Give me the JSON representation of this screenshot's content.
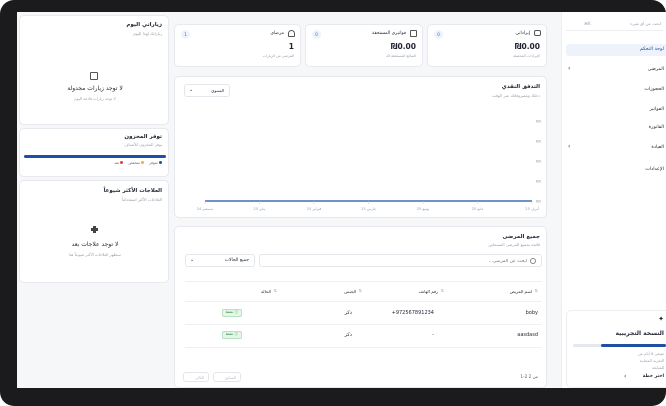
{
  "sidebar": {
    "search_placeholder": "ابحث عن أي شيء",
    "shortcut": "⌘K",
    "items": [
      {
        "label": "لوحة التحكم",
        "active": true
      },
      {
        "label": "المرضى",
        "has_children": true
      },
      {
        "label": "الحجوزات"
      },
      {
        "label": "الفواتير"
      },
      {
        "label": "الفاتورة"
      },
      {
        "label": "العيادة",
        "has_children": true
      },
      {
        "label": "الإعدادات"
      }
    ],
    "trial": {
      "title": "النسخة التجريبية",
      "line1": "متبقي 6 أيام من",
      "line2": "التجربة المجانية",
      "line3": "للمتابعة",
      "link": "اختر خطة"
    }
  },
  "stats": [
    {
      "label": "إيراداتي",
      "value": "₪0.00",
      "sub": "الإيرادات المحصلة",
      "badge": "0"
    },
    {
      "label": "فواتيري المستحقة",
      "value": "₪0.00",
      "sub": "المبالغ المستحقة لك",
      "badge": "0"
    },
    {
      "label": "مرضاي",
      "value": "1",
      "sub": "المرضى من الزيارات",
      "badge": "1"
    }
  ],
  "cashflow": {
    "title": "التدفق النقدي",
    "subtitle": "دخلك ومصروفاتك عبر الوقت",
    "period": "السنوي",
    "chart_data": {
      "type": "line",
      "x": [
        "أبريل 25",
        "مايو 25",
        "يونيو 25",
        "مارس 25",
        "فبراير 25",
        "يناير 25",
        "ديسمبر 24"
      ],
      "series": [
        {
          "values": [
            0,
            0,
            0,
            0,
            0,
            0,
            0
          ]
        }
      ],
      "yticks": [
        "₪0",
        "₪0",
        "₪0",
        "₪0",
        "₪0"
      ],
      "grid": false
    }
  },
  "visits": {
    "title": "زياراتي اليوم",
    "subtitle": "زياراتك لهذا اليوم",
    "empty_title": "لا توجد زيارات مجدولة",
    "empty_sub": "لا توجد زيارات قادمة اليوم"
  },
  "inventory": {
    "title": "توفر المخزون",
    "subtitle": "توفر المخزون للأصناف",
    "progress": 1.0,
    "bar_color": "#1d4fa3",
    "legend": [
      "متوفر",
      "منخفض",
      "نفد"
    ]
  },
  "treatments": {
    "title": "العلاجات الأكثر شيوعاً",
    "subtitle": "العلاجات الأكثر استخداماً",
    "empty_title": "لا توجد علاجات بعد",
    "empty_sub": "ستظهر العلاجات الأكثر شيوعاً هنا"
  },
  "patients": {
    "title": "جميع المرضى",
    "subtitle": "قائمة بجميع المرضى المسجلين",
    "search_placeholder": "ابحث عن المرضى...",
    "filter": "جميع الحالات",
    "columns": [
      "اسم المريض",
      "رقم الهاتف",
      "الجنس",
      "الحالة"
    ],
    "rows": [
      {
        "name": "boby",
        "phone": "+972567891234",
        "gender": "ذكر",
        "status": "نشط"
      },
      {
        "name": "aasdasd",
        "phone": "-",
        "gender": "ذكر",
        "status": "نشط"
      }
    ],
    "pagination": {
      "info": "1-2 من 2",
      "prev": "السابق",
      "next": "التالي"
    }
  },
  "colors": {
    "accent": "#1d4fa3",
    "active_bg": "#eef2fb",
    "success": "#2e8a45"
  }
}
